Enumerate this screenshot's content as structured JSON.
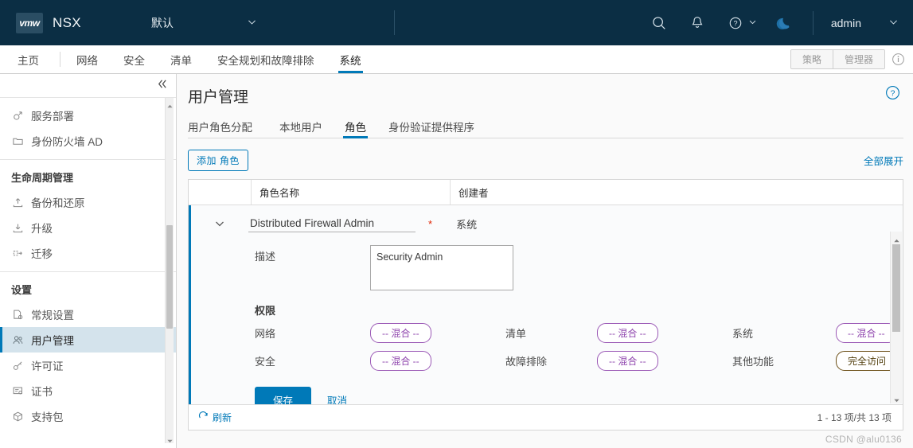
{
  "header": {
    "logo_text": "vmw",
    "product": "NSX",
    "tenant": "默认",
    "user": "admin",
    "icons": [
      "search-icon",
      "bell-icon",
      "help-icon",
      "dark-mode-icon"
    ]
  },
  "nav": {
    "items": [
      {
        "label": "主页",
        "active": false
      },
      {
        "label": "网络",
        "active": false
      },
      {
        "label": "安全",
        "active": false
      },
      {
        "label": "清单",
        "active": false
      },
      {
        "label": "安全规划和故障排除",
        "active": false
      },
      {
        "label": "系统",
        "active": true
      }
    ],
    "mode_toggle": [
      "策略",
      "管理器"
    ],
    "info_icon": "info-icon"
  },
  "sidebar": {
    "collapse_icon": "double-chevron-left-icon",
    "top_items": [
      {
        "label": "服务部署",
        "icon": "deployment-icon"
      },
      {
        "label": "身份防火墙 AD",
        "icon": "folder-icon"
      }
    ],
    "sections": [
      {
        "title": "生命周期管理",
        "items": [
          {
            "label": "备份和还原",
            "icon": "backup-icon"
          },
          {
            "label": "升级",
            "icon": "upgrade-icon"
          },
          {
            "label": "迁移",
            "icon": "migrate-icon"
          }
        ]
      },
      {
        "title": "设置",
        "items": [
          {
            "label": "常规设置",
            "icon": "general-settings-icon",
            "selected": false
          },
          {
            "label": "用户管理",
            "icon": "users-icon",
            "selected": true
          },
          {
            "label": "许可证",
            "icon": "license-key-icon",
            "selected": false
          },
          {
            "label": "证书",
            "icon": "certificate-icon",
            "selected": false
          },
          {
            "label": "支持包",
            "icon": "support-bundle-icon",
            "selected": false
          }
        ]
      }
    ]
  },
  "main": {
    "page_title": "用户管理",
    "help_icon": "help-circle-icon",
    "tabs": [
      {
        "label": "用户角色分配",
        "active": false
      },
      {
        "label": "本地用户",
        "active": false
      },
      {
        "label": "角色",
        "active": true
      },
      {
        "label": "身份验证提供程序",
        "active": false
      }
    ],
    "toolbar": {
      "add_button": "添加 角色",
      "expand_all": "全部展开"
    },
    "table": {
      "columns": [
        "角色名称",
        "创建者"
      ],
      "row": {
        "chevron_icon": "chevron-down-icon",
        "role_name": "Distributed Firewall Admin",
        "required_marker": "*",
        "creator": "系统",
        "description_label": "描述",
        "description_value": "Security Admin",
        "permissions_title": "权限",
        "permissions": [
          {
            "label": "网络",
            "value": "-- 混合 --",
            "kind": "mixed"
          },
          {
            "label": "清单",
            "value": "-- 混合 --",
            "kind": "mixed"
          },
          {
            "label": "系统",
            "value": "-- 混合 --",
            "kind": "mixed"
          },
          {
            "label": "安全",
            "value": "-- 混合 --",
            "kind": "mixed"
          },
          {
            "label": "故障排除",
            "value": "-- 混合 --",
            "kind": "mixed"
          },
          {
            "label": "其他功能",
            "value": "完全访问",
            "kind": "full"
          }
        ],
        "save_button": "保存",
        "cancel_button": "取消"
      }
    },
    "footer": {
      "refresh_icon": "refresh-icon",
      "refresh_label": "刷新",
      "count": "1 - 13 项/共 13 项"
    }
  },
  "watermark": "CSDN @alu0136",
  "colors": {
    "header_bg": "#0b2e44",
    "accent": "#0079b8",
    "selected_row": "#d4e3ec",
    "pill_mixed": "#8e44ad",
    "pill_full": "#53400f",
    "required": "#e02200"
  }
}
